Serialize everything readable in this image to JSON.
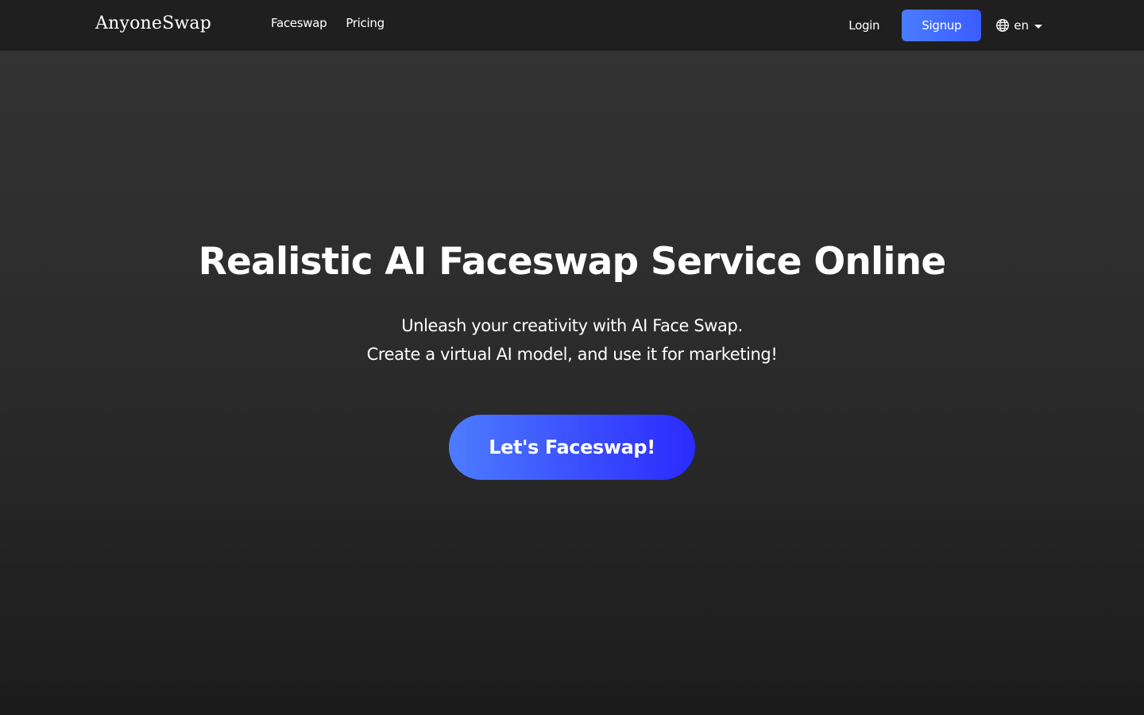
{
  "header": {
    "logo": "AnyoneSwap",
    "nav": [
      {
        "label": "Faceswap"
      },
      {
        "label": "Pricing"
      }
    ],
    "login_label": "Login",
    "signup_label": "Signup",
    "language": {
      "selected": "en",
      "icon": "globe-icon"
    }
  },
  "hero": {
    "title": "Realistic AI Faceswap Service Online",
    "subtitle_line1": "Unleash your creativity with AI Face Swap.",
    "subtitle_line2": "Create a virtual AI model, and use it for marketing!",
    "cta_label": "Let's Faceswap!"
  },
  "colors": {
    "accent": "#4a7cff",
    "accent_dark": "#2b2bff",
    "header_bg": "#1f1f1f",
    "page_bg": "#2a2a2a"
  }
}
